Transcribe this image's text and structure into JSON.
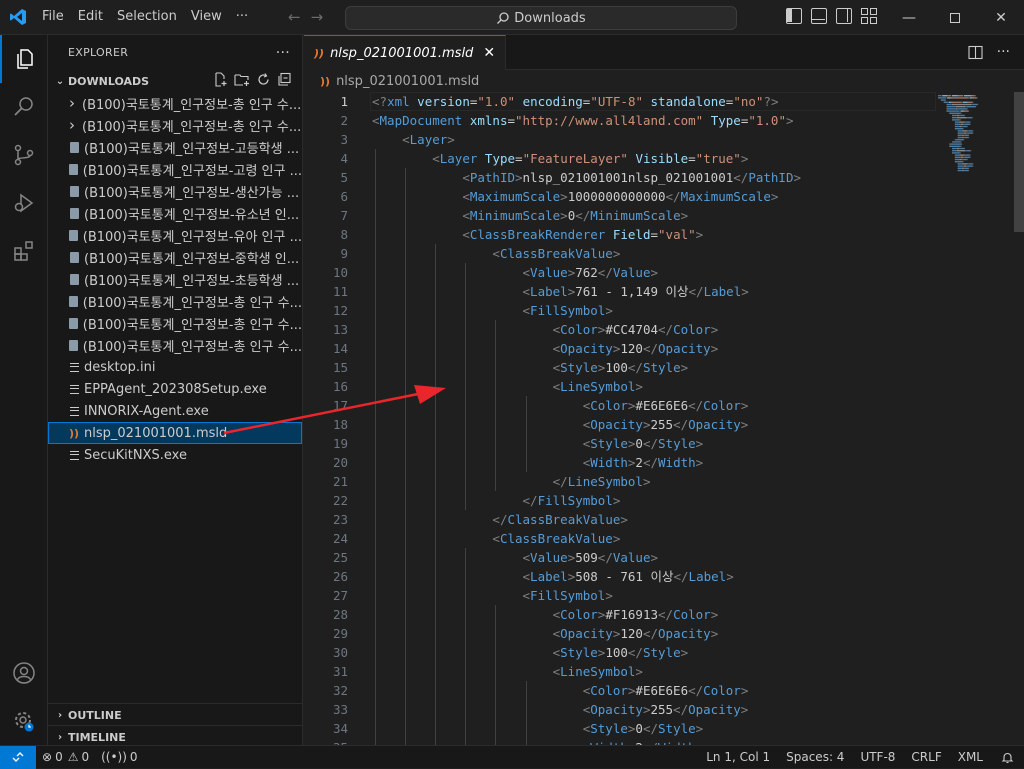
{
  "titlebar": {
    "menu": [
      "File",
      "Edit",
      "Selection",
      "View",
      "···"
    ],
    "search": "Downloads"
  },
  "explorer": {
    "title": "EXPLORER",
    "more": "···",
    "folder": "DOWNLOADS",
    "items": [
      {
        "label": "(B100)국토통계_인구정보-총 인구 수...",
        "kind": "folder"
      },
      {
        "label": "(B100)국토통계_인구정보-총 인구 수...",
        "kind": "folder"
      },
      {
        "label": "(B100)국토통계_인구정보-고등학생 ...",
        "kind": "file"
      },
      {
        "label": "(B100)국토통계_인구정보-고령 인구 ...",
        "kind": "file"
      },
      {
        "label": "(B100)국토통계_인구정보-생산가능 ...",
        "kind": "file"
      },
      {
        "label": "(B100)국토통계_인구정보-유소년 인...",
        "kind": "file"
      },
      {
        "label": "(B100)국토통계_인구정보-유아 인구 ...",
        "kind": "file"
      },
      {
        "label": "(B100)국토통계_인구정보-중학생 인...",
        "kind": "file"
      },
      {
        "label": "(B100)국토통계_인구정보-초등학생 ...",
        "kind": "file"
      },
      {
        "label": "(B100)국토통계_인구정보-총 인구 수...",
        "kind": "file"
      },
      {
        "label": "(B100)국토통계_인구정보-총 인구 수...",
        "kind": "file"
      },
      {
        "label": "(B100)국토통계_인구정보-총 인구 수...",
        "kind": "file"
      },
      {
        "label": "desktop.ini",
        "kind": "lines"
      },
      {
        "label": "EPPAgent_202308Setup.exe",
        "kind": "lines"
      },
      {
        "label": "INNORIX-Agent.exe",
        "kind": "lines"
      },
      {
        "label": "nlsp_021001001.msld",
        "kind": "rss"
      },
      {
        "label": "SecuKitNXS.exe",
        "kind": "lines"
      }
    ],
    "outline": "OUTLINE",
    "timeline": "TIMELINE"
  },
  "editor": {
    "tab": "nlsp_021001001.msld",
    "breadcrumb": "nlsp_021001001.msld",
    "lines": [
      [
        [
          "p",
          "<?"
        ],
        [
          "tag",
          "xml"
        ],
        [
          "t",
          " "
        ],
        [
          "attr",
          "version"
        ],
        [
          "t",
          "="
        ],
        [
          "str",
          "\"1.0\""
        ],
        [
          "t",
          " "
        ],
        [
          "attr",
          "encoding"
        ],
        [
          "t",
          "="
        ],
        [
          "str",
          "\"UTF-8\""
        ],
        [
          "t",
          " "
        ],
        [
          "attr",
          "standalone"
        ],
        [
          "t",
          "="
        ],
        [
          "str",
          "\"no\""
        ],
        [
          "p",
          "?>"
        ]
      ],
      [
        [
          "p",
          "<"
        ],
        [
          "tag",
          "MapDocument"
        ],
        [
          "t",
          " "
        ],
        [
          "attr",
          "xmlns"
        ],
        [
          "t",
          "="
        ],
        [
          "str",
          "\"http://www.all4land.com\""
        ],
        [
          "t",
          " "
        ],
        [
          "attr",
          "Type"
        ],
        [
          "t",
          "="
        ],
        [
          "str",
          "\"1.0\""
        ],
        [
          "p",
          ">"
        ]
      ],
      [
        [
          "t",
          "    "
        ],
        [
          "p",
          "<"
        ],
        [
          "tag",
          "Layer"
        ],
        [
          "p",
          ">"
        ]
      ],
      [
        [
          "t",
          "        "
        ],
        [
          "p",
          "<"
        ],
        [
          "tag",
          "Layer"
        ],
        [
          "t",
          " "
        ],
        [
          "attr",
          "Type"
        ],
        [
          "t",
          "="
        ],
        [
          "str",
          "\"FeatureLayer\""
        ],
        [
          "t",
          " "
        ],
        [
          "attr",
          "Visible"
        ],
        [
          "t",
          "="
        ],
        [
          "str",
          "\"true\""
        ],
        [
          "p",
          ">"
        ]
      ],
      [
        [
          "t",
          "            "
        ],
        [
          "p",
          "<"
        ],
        [
          "tag",
          "PathID"
        ],
        [
          "p",
          ">"
        ],
        [
          "t",
          "nlsp_021001001nlsp_021001001"
        ],
        [
          "p",
          "</"
        ],
        [
          "tag",
          "PathID"
        ],
        [
          "p",
          ">"
        ]
      ],
      [
        [
          "t",
          "            "
        ],
        [
          "p",
          "<"
        ],
        [
          "tag",
          "MaximumScale"
        ],
        [
          "p",
          ">"
        ],
        [
          "t",
          "1000000000000"
        ],
        [
          "p",
          "</"
        ],
        [
          "tag",
          "MaximumScale"
        ],
        [
          "p",
          ">"
        ]
      ],
      [
        [
          "t",
          "            "
        ],
        [
          "p",
          "<"
        ],
        [
          "tag",
          "MinimumScale"
        ],
        [
          "p",
          ">"
        ],
        [
          "t",
          "0"
        ],
        [
          "p",
          "</"
        ],
        [
          "tag",
          "MinimumScale"
        ],
        [
          "p",
          ">"
        ]
      ],
      [
        [
          "t",
          "            "
        ],
        [
          "p",
          "<"
        ],
        [
          "tag",
          "ClassBreakRenderer"
        ],
        [
          "t",
          " "
        ],
        [
          "attr",
          "Field"
        ],
        [
          "t",
          "="
        ],
        [
          "str",
          "\"val\""
        ],
        [
          "p",
          ">"
        ]
      ],
      [
        [
          "t",
          "                "
        ],
        [
          "p",
          "<"
        ],
        [
          "tag",
          "ClassBreakValue"
        ],
        [
          "p",
          ">"
        ]
      ],
      [
        [
          "t",
          "                    "
        ],
        [
          "p",
          "<"
        ],
        [
          "tag",
          "Value"
        ],
        [
          "p",
          ">"
        ],
        [
          "t",
          "762"
        ],
        [
          "p",
          "</"
        ],
        [
          "tag",
          "Value"
        ],
        [
          "p",
          ">"
        ]
      ],
      [
        [
          "t",
          "                    "
        ],
        [
          "p",
          "<"
        ],
        [
          "tag",
          "Label"
        ],
        [
          "p",
          ">"
        ],
        [
          "t",
          "761 - 1,149 이상"
        ],
        [
          "p",
          "</"
        ],
        [
          "tag",
          "Label"
        ],
        [
          "p",
          ">"
        ]
      ],
      [
        [
          "t",
          "                    "
        ],
        [
          "p",
          "<"
        ],
        [
          "tag",
          "FillSymbol"
        ],
        [
          "p",
          ">"
        ]
      ],
      [
        [
          "t",
          "                        "
        ],
        [
          "p",
          "<"
        ],
        [
          "tag",
          "Color"
        ],
        [
          "p",
          ">"
        ],
        [
          "t",
          "#CC4704"
        ],
        [
          "p",
          "</"
        ],
        [
          "tag",
          "Color"
        ],
        [
          "p",
          ">"
        ]
      ],
      [
        [
          "t",
          "                        "
        ],
        [
          "p",
          "<"
        ],
        [
          "tag",
          "Opacity"
        ],
        [
          "p",
          ">"
        ],
        [
          "t",
          "120"
        ],
        [
          "p",
          "</"
        ],
        [
          "tag",
          "Opacity"
        ],
        [
          "p",
          ">"
        ]
      ],
      [
        [
          "t",
          "                        "
        ],
        [
          "p",
          "<"
        ],
        [
          "tag",
          "Style"
        ],
        [
          "p",
          ">"
        ],
        [
          "t",
          "100"
        ],
        [
          "p",
          "</"
        ],
        [
          "tag",
          "Style"
        ],
        [
          "p",
          ">"
        ]
      ],
      [
        [
          "t",
          "                        "
        ],
        [
          "p",
          "<"
        ],
        [
          "tag",
          "LineSymbol"
        ],
        [
          "p",
          ">"
        ]
      ],
      [
        [
          "t",
          "                            "
        ],
        [
          "p",
          "<"
        ],
        [
          "tag",
          "Color"
        ],
        [
          "p",
          ">"
        ],
        [
          "t",
          "#E6E6E6"
        ],
        [
          "p",
          "</"
        ],
        [
          "tag",
          "Color"
        ],
        [
          "p",
          ">"
        ]
      ],
      [
        [
          "t",
          "                            "
        ],
        [
          "p",
          "<"
        ],
        [
          "tag",
          "Opacity"
        ],
        [
          "p",
          ">"
        ],
        [
          "t",
          "255"
        ],
        [
          "p",
          "</"
        ],
        [
          "tag",
          "Opacity"
        ],
        [
          "p",
          ">"
        ]
      ],
      [
        [
          "t",
          "                            "
        ],
        [
          "p",
          "<"
        ],
        [
          "tag",
          "Style"
        ],
        [
          "p",
          ">"
        ],
        [
          "t",
          "0"
        ],
        [
          "p",
          "</"
        ],
        [
          "tag",
          "Style"
        ],
        [
          "p",
          ">"
        ]
      ],
      [
        [
          "t",
          "                            "
        ],
        [
          "p",
          "<"
        ],
        [
          "tag",
          "Width"
        ],
        [
          "p",
          ">"
        ],
        [
          "t",
          "2"
        ],
        [
          "p",
          "</"
        ],
        [
          "tag",
          "Width"
        ],
        [
          "p",
          ">"
        ]
      ],
      [
        [
          "t",
          "                        "
        ],
        [
          "p",
          "</"
        ],
        [
          "tag",
          "LineSymbol"
        ],
        [
          "p",
          ">"
        ]
      ],
      [
        [
          "t",
          "                    "
        ],
        [
          "p",
          "</"
        ],
        [
          "tag",
          "FillSymbol"
        ],
        [
          "p",
          ">"
        ]
      ],
      [
        [
          "t",
          "                "
        ],
        [
          "p",
          "</"
        ],
        [
          "tag",
          "ClassBreakValue"
        ],
        [
          "p",
          ">"
        ]
      ],
      [
        [
          "t",
          "                "
        ],
        [
          "p",
          "<"
        ],
        [
          "tag",
          "ClassBreakValue"
        ],
        [
          "p",
          ">"
        ]
      ],
      [
        [
          "t",
          "                    "
        ],
        [
          "p",
          "<"
        ],
        [
          "tag",
          "Value"
        ],
        [
          "p",
          ">"
        ],
        [
          "t",
          "509"
        ],
        [
          "p",
          "</"
        ],
        [
          "tag",
          "Value"
        ],
        [
          "p",
          ">"
        ]
      ],
      [
        [
          "t",
          "                    "
        ],
        [
          "p",
          "<"
        ],
        [
          "tag",
          "Label"
        ],
        [
          "p",
          ">"
        ],
        [
          "t",
          "508 - 761 이상"
        ],
        [
          "p",
          "</"
        ],
        [
          "tag",
          "Label"
        ],
        [
          "p",
          ">"
        ]
      ],
      [
        [
          "t",
          "                    "
        ],
        [
          "p",
          "<"
        ],
        [
          "tag",
          "FillSymbol"
        ],
        [
          "p",
          ">"
        ]
      ],
      [
        [
          "t",
          "                        "
        ],
        [
          "p",
          "<"
        ],
        [
          "tag",
          "Color"
        ],
        [
          "p",
          ">"
        ],
        [
          "t",
          "#F16913"
        ],
        [
          "p",
          "</"
        ],
        [
          "tag",
          "Color"
        ],
        [
          "p",
          ">"
        ]
      ],
      [
        [
          "t",
          "                        "
        ],
        [
          "p",
          "<"
        ],
        [
          "tag",
          "Opacity"
        ],
        [
          "p",
          ">"
        ],
        [
          "t",
          "120"
        ],
        [
          "p",
          "</"
        ],
        [
          "tag",
          "Opacity"
        ],
        [
          "p",
          ">"
        ]
      ],
      [
        [
          "t",
          "                        "
        ],
        [
          "p",
          "<"
        ],
        [
          "tag",
          "Style"
        ],
        [
          "p",
          ">"
        ],
        [
          "t",
          "100"
        ],
        [
          "p",
          "</"
        ],
        [
          "tag",
          "Style"
        ],
        [
          "p",
          ">"
        ]
      ],
      [
        [
          "t",
          "                        "
        ],
        [
          "p",
          "<"
        ],
        [
          "tag",
          "LineSymbol"
        ],
        [
          "p",
          ">"
        ]
      ],
      [
        [
          "t",
          "                            "
        ],
        [
          "p",
          "<"
        ],
        [
          "tag",
          "Color"
        ],
        [
          "p",
          ">"
        ],
        [
          "t",
          "#E6E6E6"
        ],
        [
          "p",
          "</"
        ],
        [
          "tag",
          "Color"
        ],
        [
          "p",
          ">"
        ]
      ],
      [
        [
          "t",
          "                            "
        ],
        [
          "p",
          "<"
        ],
        [
          "tag",
          "Opacity"
        ],
        [
          "p",
          ">"
        ],
        [
          "t",
          "255"
        ],
        [
          "p",
          "</"
        ],
        [
          "tag",
          "Opacity"
        ],
        [
          "p",
          ">"
        ]
      ],
      [
        [
          "t",
          "                            "
        ],
        [
          "p",
          "<"
        ],
        [
          "tag",
          "Style"
        ],
        [
          "p",
          ">"
        ],
        [
          "t",
          "0"
        ],
        [
          "p",
          "</"
        ],
        [
          "tag",
          "Style"
        ],
        [
          "p",
          ">"
        ]
      ],
      [
        [
          "t",
          "                            "
        ],
        [
          "p",
          "<"
        ],
        [
          "tag",
          "Width"
        ],
        [
          "p",
          ">"
        ],
        [
          "t",
          "2"
        ],
        [
          "p",
          "</"
        ],
        [
          "tag",
          "Width"
        ],
        [
          "p",
          ">"
        ]
      ]
    ]
  },
  "statusbar": {
    "errors": "0",
    "warnings": "0",
    "ports": "0",
    "position": "Ln 1, Col 1",
    "spaces": "Spaces: 4",
    "encoding": "UTF-8",
    "eol": "CRLF",
    "language": "XML"
  },
  "colors": {
    "accent": "#0078d4",
    "annotation_arrow": "#e8262b"
  }
}
